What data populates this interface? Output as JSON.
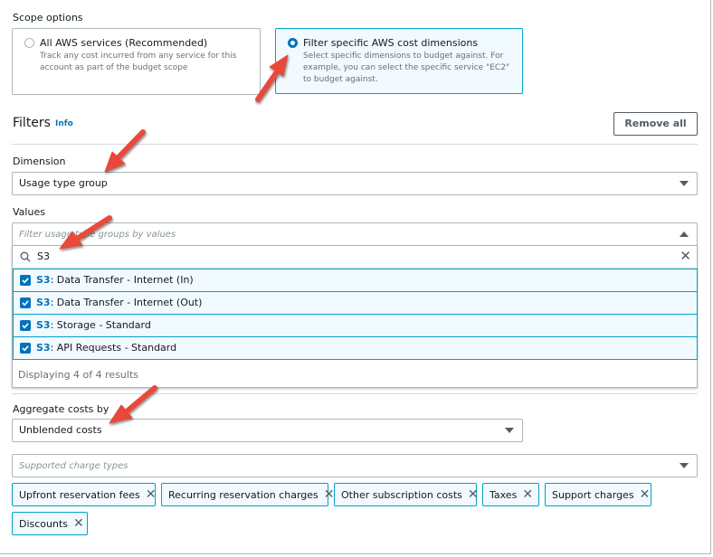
{
  "scope": {
    "label": "Scope options",
    "options": [
      {
        "title": "All AWS services (Recommended)",
        "description": "Track any cost incurred from any service for this account as part of the budget scope",
        "selected": false
      },
      {
        "title": "Filter specific AWS cost dimensions",
        "description": "Select specific dimensions to budget against. For example, you can select the specific service \"EC2\" to budget against.",
        "selected": true
      }
    ]
  },
  "filters": {
    "heading": "Filters",
    "info_link": "Info",
    "remove_all": "Remove all",
    "dimension": {
      "label": "Dimension",
      "value": "Usage type group"
    },
    "values": {
      "label": "Values",
      "placeholder": "Filter usage type groups by values",
      "search_value": "S3",
      "options": [
        {
          "prefix": "S3",
          "text": ": Data Transfer - Internet (In)",
          "checked": true
        },
        {
          "prefix": "S3",
          "text": ": Data Transfer - Internet (Out)",
          "checked": true
        },
        {
          "prefix": "S3",
          "text": ": Storage - Standard",
          "checked": true
        },
        {
          "prefix": "S3",
          "text": ": API Requests - Standard",
          "checked": true
        }
      ],
      "results_text": "Displaying 4 of 4 results"
    }
  },
  "aggregate": {
    "label": "Aggregate costs by",
    "value": "Unblended costs"
  },
  "charge_types": {
    "placeholder": "Supported charge types",
    "tokens": [
      "Upfront reservation fees",
      "Recurring reservation charges",
      "Other subscription costs",
      "Taxes",
      "Support charges",
      "Discounts"
    ]
  },
  "colors": {
    "accent": "#0073bb",
    "selected_border": "#00a1c9",
    "selected_bg": "#f1faff",
    "annotation_arrow": "#e8483a"
  }
}
